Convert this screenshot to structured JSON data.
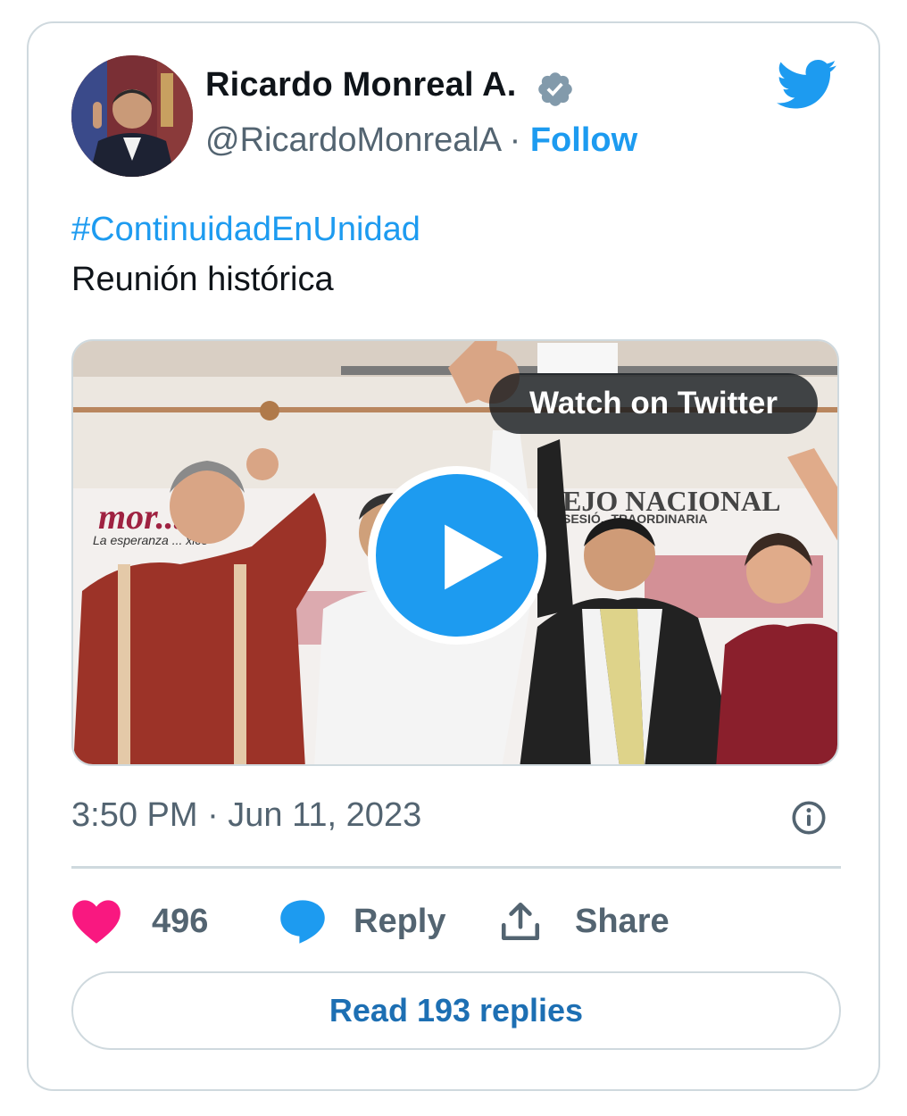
{
  "author": {
    "name": "Ricardo Monreal A.",
    "handle": "@RicardoMonrealA",
    "separator": "·",
    "follow_label": "Follow"
  },
  "tweet": {
    "hashtag": "#ContinuidadEnUnidad",
    "text": "Reunión histórica"
  },
  "media": {
    "watch_label": "Watch on Twitter",
    "banner_left_logo": "mor...a",
    "banner_left_tagline": "La esperanza ... xico",
    "banner_right_title": "EJO NACIONAL",
    "banner_right_subtitle": "SESIÓ...TRAORDINARIA"
  },
  "meta": {
    "timestamp": "3:50 PM · Jun 11, 2023"
  },
  "actions": {
    "like_count": "496",
    "reply_label": "Reply",
    "share_label": "Share"
  },
  "read_replies_label": "Read 193 replies",
  "colors": {
    "accent": "#1d9bf0",
    "like": "#f91880",
    "text_secondary": "#536471",
    "border": "#cfd9de"
  },
  "icons": [
    "verified-badge-icon",
    "twitter-bird-icon",
    "play-icon",
    "info-icon",
    "heart-icon",
    "reply-bubble-icon",
    "share-icon"
  ]
}
